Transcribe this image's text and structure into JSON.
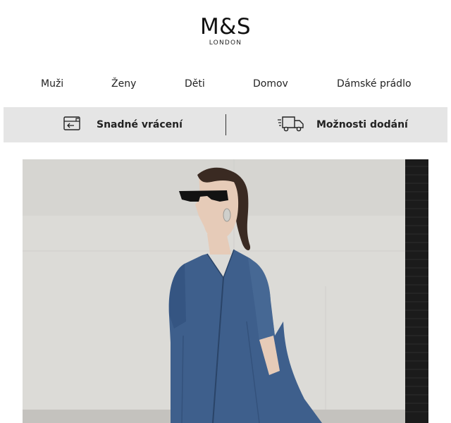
{
  "brand": {
    "name": "M&S",
    "tagline": "LONDON"
  },
  "nav": {
    "items": [
      {
        "label": "Muži"
      },
      {
        "label": "Ženy"
      },
      {
        "label": "Děti"
      },
      {
        "label": "Domov"
      },
      {
        "label": "Dámské prádlo"
      }
    ]
  },
  "info_bar": {
    "returns": {
      "label": "Snadné vrácení",
      "icon": "return-parcel-icon"
    },
    "delivery": {
      "label": "Možnosti dodání",
      "icon": "delivery-truck-icon"
    }
  },
  "hero": {
    "image": "woman-in-denim-dress-photo",
    "colors": {
      "wall": "#d9d8d4",
      "denim": "#3d5f8a",
      "shutter": "#1b1b1b"
    }
  }
}
